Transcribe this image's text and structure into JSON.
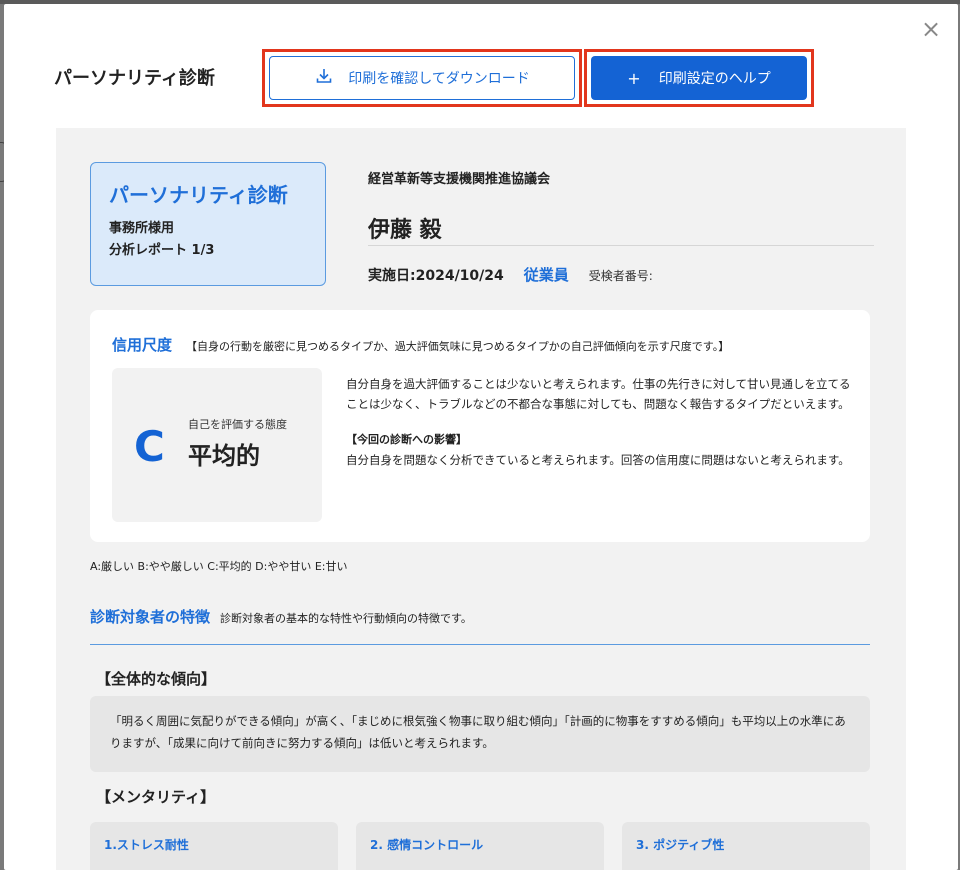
{
  "modal": {
    "title": "パーソナリティ診断",
    "close_icon": "close-icon",
    "download_button": {
      "label": "印刷を確認してダウンロード",
      "icon": "download-icon"
    },
    "help_button": {
      "label": "印刷設定のヘルプ",
      "icon": "plus-icon"
    },
    "colors": {
      "accent": "#1463d4",
      "highlight": "#e2361d"
    }
  },
  "report": {
    "badge": {
      "title": "パーソナリティ診断",
      "line1": "事務所様用",
      "line2": "分析レポート 1/3"
    },
    "organization": "経営革新等支援機関推進協議会",
    "person_name": "伊藤 毅",
    "date": "実施日:2024/10/24",
    "person_type": "従業員",
    "examinee_number": "受検者番号:",
    "credibility": {
      "title": "信用尺度",
      "description": "【自身の行動を厳密に見つめるタイプか、過大評価気味に見つめるタイプかの自己評価傾向を示す尺度です。】",
      "grade": "C",
      "grade_sub": "自己を評価する態度",
      "grade_value": "平均的",
      "body": "自分自身を過大評価することは少ないと考えられます。仕事の先行きに対して甘い見通しを立てることは少なく、トラブルなどの不都合な事態に対しても、問題なく報告するタイプだといえます。",
      "impact_heading": "【今回の診断への影響】",
      "impact_body": "自分自身を問題なく分析できていると考えられます。回答の信用度に問題はないと考えられます。"
    },
    "scale_legend": "A:厳しい B:やや厳しい C:平均的 D:やや甘い E:甘い",
    "traits": {
      "title": "診断対象者の特徴",
      "description": "診断対象者の基本的な特性や行動傾向の特徴です。",
      "overall_heading": "【全体的な傾向】",
      "overall_body": "「明るく周囲に気配りができる傾向」が高く、「まじめに根気強く物事に取り組む傾向」「計画的に物事をすすめる傾向」も平均以上の水準にありますが、「成果に向けて前向きに努力する傾向」は低いと考えられます。",
      "mentality_heading": "【メンタリティ】",
      "mentality_items": [
        {
          "label": "1.ストレス耐性"
        },
        {
          "label": "2. 感情コントロール"
        },
        {
          "label": "3. ポジティブ性"
        }
      ]
    }
  }
}
